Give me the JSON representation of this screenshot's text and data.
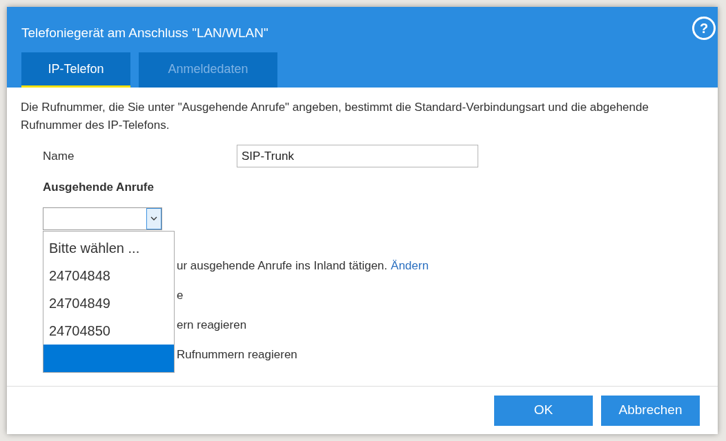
{
  "dialog": {
    "title": "Telefoniegerät am Anschluss \"LAN/WLAN\"",
    "help": "?"
  },
  "tabs": [
    {
      "label": "IP-Telefon",
      "selected": true
    },
    {
      "label": "Anmeldedaten",
      "selected": false
    }
  ],
  "intro": "Die Rufnummer, die Sie unter \"Ausgehende Anrufe\" angeben, bestimmt die Standard-Verbindungsart und die abgehende Rufnummer des IP-Telefons.",
  "name_field": {
    "label": "Name",
    "value": "SIP-Trunk"
  },
  "outgoing": {
    "label": "Ausgehende Anrufe",
    "expanded": true,
    "options": [
      {
        "label": "Bitte wählen ...",
        "selected": false
      },
      {
        "label": "24704848",
        "selected": false
      },
      {
        "label": "24704849",
        "selected": false
      },
      {
        "label": "24704850",
        "selected": false
      },
      {
        "selected": true
      }
    ]
  },
  "partial_lines": [
    {
      "text": "ur ausgehende Anrufe ins Inland tätigen.",
      "link": "Ändern"
    },
    {
      "text": "e"
    },
    {
      "text": "ern reagieren"
    },
    {
      "text": "Rufnummern reagieren"
    }
  ],
  "buttons": [
    "OK",
    "Abbrechen"
  ]
}
